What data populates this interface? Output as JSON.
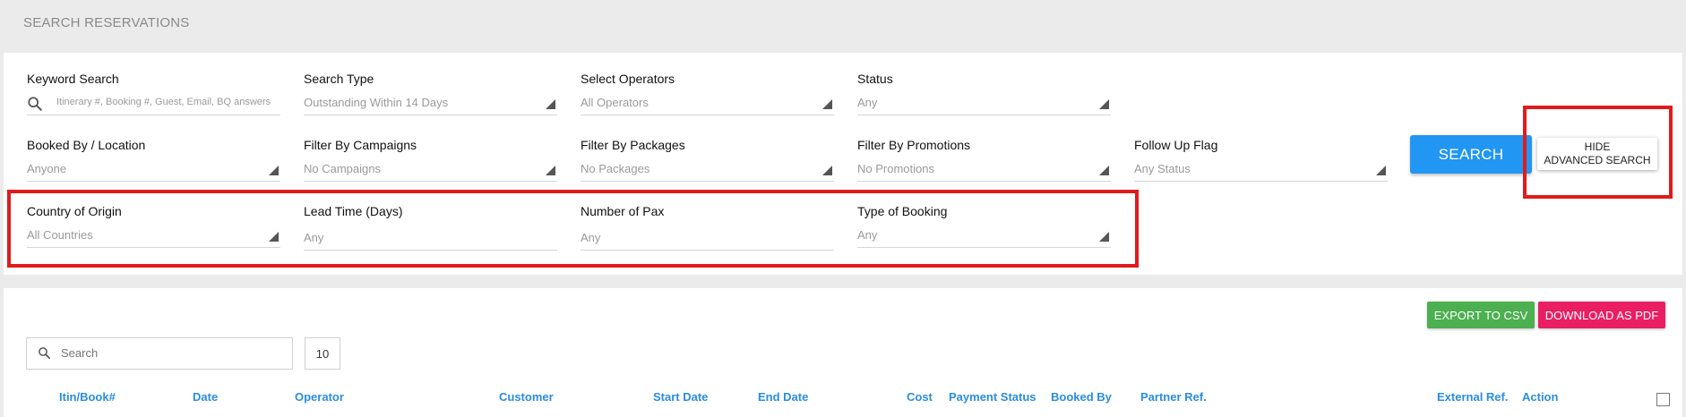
{
  "page": {
    "title": "SEARCH RESERVATIONS"
  },
  "filters": {
    "keyword": {
      "label": "Keyword Search",
      "placeholder": "Itinerary #, Booking #, Guest, Email, BQ answers"
    },
    "search_type": {
      "label": "Search Type",
      "value": "Outstanding Within 14 Days"
    },
    "operators": {
      "label": "Select Operators",
      "value": "All Operators"
    },
    "status": {
      "label": "Status",
      "value": "Any"
    },
    "booked_by": {
      "label": "Booked By / Location",
      "value": "Anyone"
    },
    "campaigns": {
      "label": "Filter By Campaigns",
      "value": "No Campaigns"
    },
    "packages": {
      "label": "Filter By Packages",
      "value": "No Packages"
    },
    "promotions": {
      "label": "Filter By Promotions",
      "value": "No Promotions"
    },
    "follow_up": {
      "label": "Follow Up Flag",
      "value": "Any Status"
    },
    "country": {
      "label": "Country of Origin",
      "value": "All Countries"
    },
    "lead_time": {
      "label": "Lead Time (Days)",
      "value": "Any"
    },
    "pax": {
      "label": "Number of Pax",
      "value": "Any"
    },
    "booking_type": {
      "label": "Type of Booking",
      "value": "Any"
    }
  },
  "actions": {
    "search_label": "SEARCH",
    "advanced_line1": "HIDE",
    "advanced_line2": "ADVANCED SEARCH"
  },
  "results": {
    "export_csv_label": "EXPORT TO CSV",
    "download_pdf_label": "DOWNLOAD AS PDF",
    "search_placeholder": "Search",
    "page_size": "10",
    "columns": [
      "Itin/Book#",
      "Date",
      "Operator",
      "Customer",
      "Start Date",
      "End Date",
      "Cost",
      "Payment Status",
      "Booked By",
      "Partner Ref.",
      "External Ref.",
      "Action"
    ]
  },
  "colors": {
    "primary": "#2196f3",
    "export": "#4caf50",
    "pdf": "#e91e63",
    "highlight": "#e01b1b",
    "header_link": "#2a8de0"
  },
  "icons": [
    "search-icon",
    "dropdown-arrow-icon",
    "checkbox"
  ]
}
